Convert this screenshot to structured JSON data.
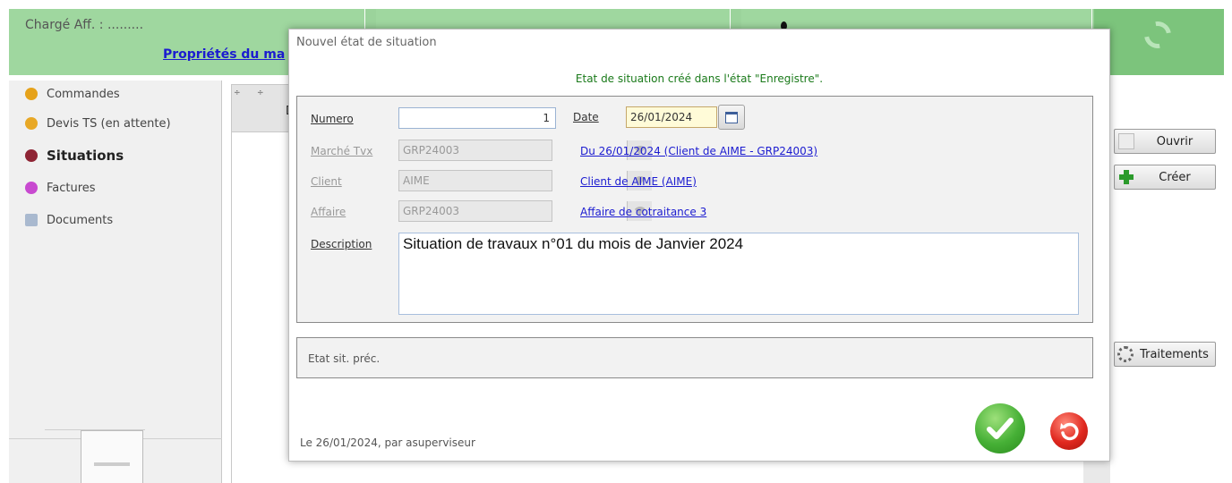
{
  "header": {
    "charge_label": "Chargé Aff. : .........",
    "props_link": "Propriétés du ma"
  },
  "sidebar": {
    "items": [
      {
        "label": "Commandes",
        "color": "#e6a21a"
      },
      {
        "label": "Devis TS (en attente)",
        "color": "#e8a826"
      },
      {
        "label": "Situations",
        "color": "#8e2434"
      },
      {
        "label": "Factures",
        "color": "#c84ad0"
      },
      {
        "label": "Documents",
        "color": "#a9b9cf"
      }
    ]
  },
  "grid": {
    "sort_markers": [
      "÷",
      "÷"
    ],
    "header_fragment": "D"
  },
  "right_buttons": {
    "open_label": "Ouvrir",
    "create_label": "Créer",
    "treatments_label": "Traitements"
  },
  "dialog": {
    "title": "Nouvel état de situation",
    "status_message": "Etat de situation créé dans l'état \"Enregistre\".",
    "fields": {
      "numero_label": "Numero",
      "numero_value": "1",
      "date_label": "Date",
      "date_value": "26/01/2024",
      "marche_label": "Marché Tvx",
      "marche_value": "GRP24003",
      "marche_link": "Du 26/01/2024 (Client de AIME - GRP24003)",
      "client_label": "Client",
      "client_value": "AIME",
      "client_link": "Client de AIME (AIME)",
      "affaire_label": "Affaire",
      "affaire_value": "GRP24003",
      "affaire_link": "Affaire de cotraitance 3",
      "description_label": "Description",
      "description_value": "Situation de travaux n°01 du mois de Janvier 2024"
    },
    "prev_state_label": "Etat sit. préc.",
    "footer": "Le 26/01/2024, par asuperviseur"
  },
  "colors": {
    "header_green": "#9fd79f",
    "link_blue": "#1b1bd0",
    "status_green": "#1a7a1a",
    "ok_green": "#46b036",
    "cancel_red": "#e0281f"
  }
}
